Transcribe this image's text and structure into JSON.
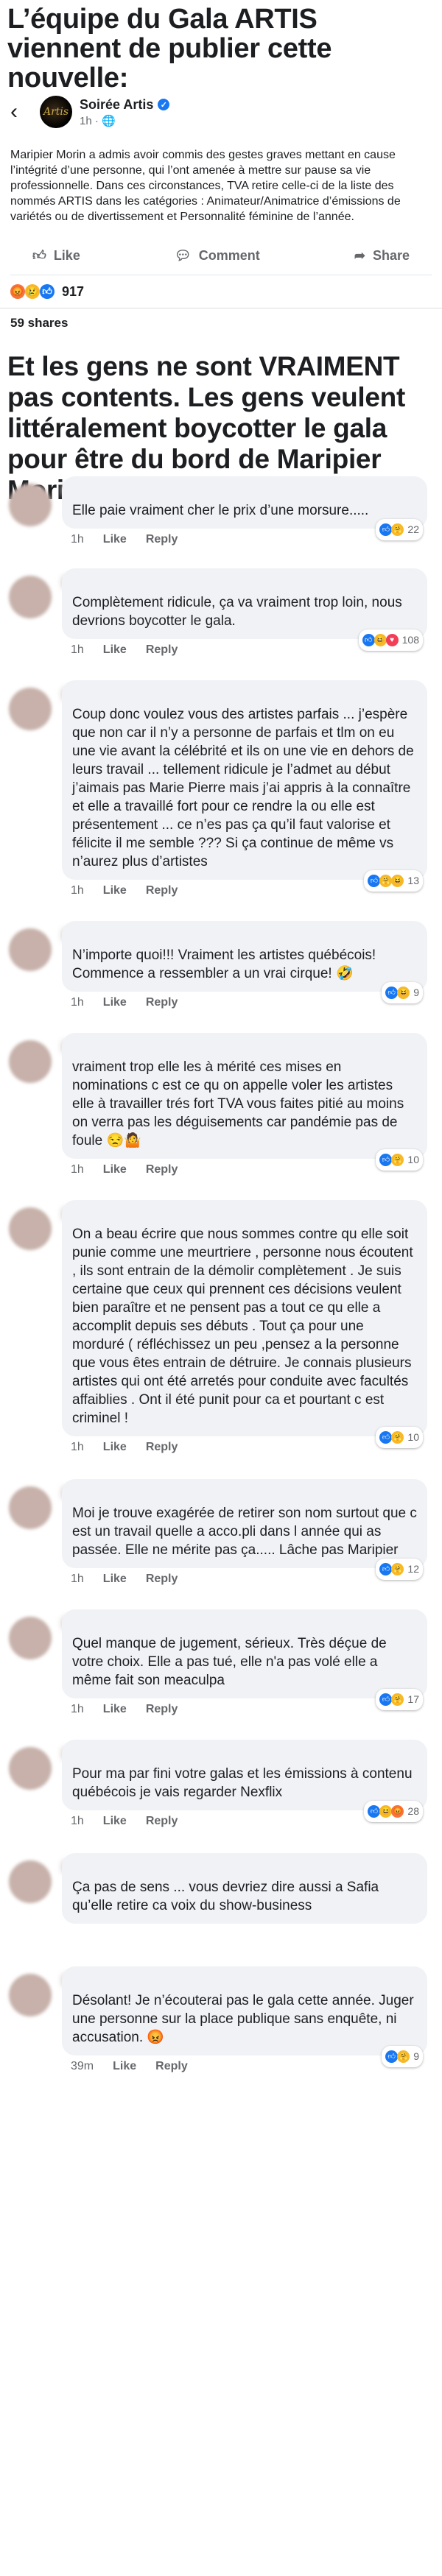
{
  "headline_top": "L’équipe du Gala ARTIS viennent de publier cette nouvelle:",
  "post": {
    "page_name": "Soirée Artis",
    "time": "1h · 🌐",
    "body": "Maripier Morin a admis avoir commis des gestes graves mettant en cause l’intégrité d’une personne, qui l’ont amenée à mettre sur pause sa vie professionnelle. Dans ces circonstances, TVA retire celle-ci de la liste des nommés ARTIS dans les catégories : Animateur/Animatrice d’émissions de variétés ou de divertissement et Personnalité féminine de l’année.",
    "actions": {
      "like": "Like",
      "comment": "Comment",
      "share": "Share"
    },
    "reactions_count": "917",
    "shares": "59 shares"
  },
  "headline_middle": "Et les gens ne sont VRAIMENT pas contents. Les gens veulent littéralement boycotter le gala pour être du bord de Maripier Morin!",
  "comment_actions": {
    "like": "Like",
    "reply": "Reply"
  },
  "comments": [
    {
      "text": "Elle paie vraiment cher le prix d’une morsure.....",
      "time": "1h",
      "count": "22",
      "icons": [
        "like",
        "care"
      ]
    },
    {
      "text": "Complètement ridicule, ça va vraiment trop loin, nous devrions boycotter le gala.",
      "time": "1h",
      "count": "108",
      "icons": [
        "like",
        "haha",
        "love"
      ]
    },
    {
      "text": "Coup donc voulez vous des artistes parfais ... j’espère que non car il n’y a personne de parfais et tlm on eu une vie avant la célébrité et ils on une vie en dehors de leurs travail ... tellement ridicule je l’admet au début j’aimais pas Marie Pierre mais j’ai appris à la connaître et elle a travaillé fort pour ce rendre la ou elle est présentement ... ce n’es pas ça qu’il faut valorise et félicite il me semble ??? Si ça continue de même vs n’aurez plus d’artistes",
      "time": "1h",
      "count": "13",
      "icons": [
        "like",
        "care",
        "haha"
      ]
    },
    {
      "text": "N’importe quoi!!!  Vraiment les artistes québécois! Commence a ressembler a un vrai cirque! 🤣",
      "time": "1h",
      "count": "9",
      "icons": [
        "like",
        "haha"
      ]
    },
    {
      "text": "vraiment trop elle les à mérité ces mises en nominations c est ce qu on appelle voler les artistes elle à travailler trés fort TVA vous faites pitié au moins on verra pas les déguisements car pandémie pas de foule 😒🤷",
      "time": "1h",
      "count": "10",
      "icons": [
        "like",
        "care"
      ]
    },
    {
      "text": "On a beau écrire que nous sommes contre qu elle soit punie comme une meurtriere , personne nous écoutent , ils sont entrain de la démolir complètement . Je suis certaine que ceux qui prennent ces décisions veulent bien paraître  et ne pensent pas a tout ce qu elle a accomplit depuis ses débuts . Tout ça pour une morduré ( réfléchissez  un peu ,pensez a la personne que vous êtes entrain de détruire. Je connais plusieurs artistes  qui ont été arretés pour conduite avec  facultés affaiblies . Ont il été punit pour ca et pourtant c est criminel !",
      "time": "1h",
      "count": "10",
      "icons": [
        "like",
        "care"
      ]
    },
    {
      "text": "Moi je trouve exagérée de retirer son nom surtout que c est un travail quelle a acco.pli dans l année qui as passée.   Elle ne mérite pas ça.....   Lâche pas Maripier",
      "time": "1h",
      "count": "12",
      "icons": [
        "like",
        "care"
      ]
    },
    {
      "text": "Quel manque de jugement, sérieux. Très déçue de votre choix. Elle a pas tué, elle n'a pas volé elle a même fait son meaculpa",
      "time": "1h",
      "count": "17",
      "icons": [
        "like",
        "care"
      ]
    },
    {
      "text": "Pour ma par fini votre galas et les émissions à contenu québécois je vais regarder Nexflix",
      "time": "1h",
      "count": "28",
      "icons": [
        "like",
        "haha",
        "angry"
      ]
    },
    {
      "text": "Ça pas de sens ... vous devriez dire aussi a Safia qu’elle retire ca voix du show-business",
      "time": "",
      "count": "",
      "icons": []
    },
    {
      "text": "Désolant! Je n’écouterai pas le gala cette année. Juger une personne sur la place publique sans enquête, ni accusation. 😡",
      "time": "39m",
      "count": "9",
      "icons": [
        "like",
        "care"
      ]
    }
  ],
  "colors": {
    "link_blue": "#1877f2",
    "bubble_gray": "#f0f2f5",
    "meta_gray": "#65676b"
  }
}
